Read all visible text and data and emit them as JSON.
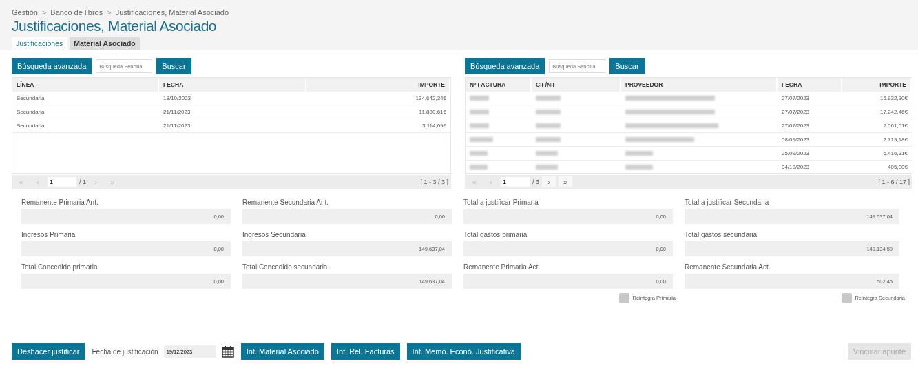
{
  "breadcrumb": [
    "Gestión",
    "Banco de libros",
    "Justificaciones, Material Asociado"
  ],
  "breadcrumb_separator": ">",
  "title": "Justificaciones, Material Asociado",
  "tabs": [
    {
      "label": "Justificaciones",
      "selected": true
    },
    {
      "label": "Material Asociado",
      "selected": false
    }
  ],
  "left_panel": {
    "search": {
      "advanced_button": "Búsqueda avanzada",
      "placeholder": "Búsqueda Sencilla",
      "search_button": "Buscar"
    },
    "table": {
      "columns": [
        "LÍNEA",
        "FECHA",
        "IMPORTE"
      ],
      "rows": [
        [
          "Secundaria",
          "18/10/2023",
          "134.642,34€"
        ],
        [
          "Secundaria",
          "21/11/2023",
          "11.880,61€"
        ],
        [
          "Secundaria",
          "21/11/2023",
          "3.114,09€"
        ]
      ]
    },
    "pager": {
      "buttons": [
        {
          "label": "«",
          "disabled": true
        },
        {
          "label": "‹",
          "disabled": true
        }
      ],
      "page": "1",
      "total": "/ 1",
      "after": [
        {
          "label": "›",
          "disabled": true
        },
        {
          "label": "»",
          "disabled": true
        }
      ],
      "range": "[ 1 - 3 / 3 ]"
    }
  },
  "right_panel": {
    "search": {
      "advanced_button": "Búsqueda avanzada",
      "placeholder": "Búsqueda Sencilla",
      "search_button": "Buscar"
    },
    "table": {
      "columns": [
        "Nº FACTURA",
        "CIF/NIF",
        "PROVEEDOR",
        "FECHA",
        "IMPORTE"
      ],
      "rows": [
        {
          "fecha": "27/07/2023",
          "importe": "15.932,30€"
        },
        {
          "fecha": "27/07/2023",
          "importe": "17.242,46€"
        },
        {
          "fecha": "27/07/2023",
          "importe": "2.061,51€"
        },
        {
          "fecha": "08/09/2023",
          "importe": "2.719,18€"
        },
        {
          "fecha": "25/09/2023",
          "importe": "6.416,31€"
        },
        {
          "fecha": "04/10/2023",
          "importe": "405,00€"
        }
      ]
    },
    "pager": {
      "buttons": [
        {
          "label": "«",
          "disabled": true
        },
        {
          "label": "‹",
          "disabled": true
        }
      ],
      "page": "1",
      "total": "/ 3",
      "after": [
        {
          "label": "›",
          "disabled": false
        },
        {
          "label": "»",
          "disabled": false
        }
      ],
      "range": "[ 1 - 6 / 17 ]"
    }
  },
  "fields": [
    [
      {
        "label": "Remanente Primaria Ant.",
        "value": "0,00"
      },
      {
        "label": "Remanente Secundaria Ant.",
        "value": "0,00"
      },
      {
        "label": "Total a justificar Primaria",
        "value": "0,00"
      },
      {
        "label": "Total a justificar Secundaria",
        "value": "149.637,04"
      }
    ],
    [
      {
        "label": "Ingresos Primaria",
        "value": "0,00"
      },
      {
        "label": "Ingresos Secundaria",
        "value": "149.637,04"
      },
      {
        "label": "Total gastos primaria",
        "value": "0,00"
      },
      {
        "label": "Total gastos secundaria",
        "value": "149.134,59"
      }
    ],
    [
      {
        "label": "Total Concedido primaria",
        "value": "0,00"
      },
      {
        "label": "Total Concedido secundaria",
        "value": "149.637,04"
      },
      {
        "label": "Remanente Primaria Act.",
        "value": "0,00"
      },
      {
        "label": "Remanente Secundaria Act.",
        "value": "502,45"
      }
    ]
  ],
  "checkboxes": [
    {
      "label": "Reintegra Primaria",
      "checked": false
    },
    {
      "label": "Reintegra Secundaria",
      "checked": false
    }
  ],
  "footer": {
    "undo_button": "Deshacer justificar",
    "date_label": "Fecha de justificación",
    "date_value": "19/12/2023",
    "report_buttons": [
      "Inf. Material Asociado",
      "Inf. Rel. Facturas",
      "Inf. Memo. Econó. Justificativa"
    ],
    "link_button": {
      "label": "Vincular apunte",
      "disabled": true
    }
  }
}
